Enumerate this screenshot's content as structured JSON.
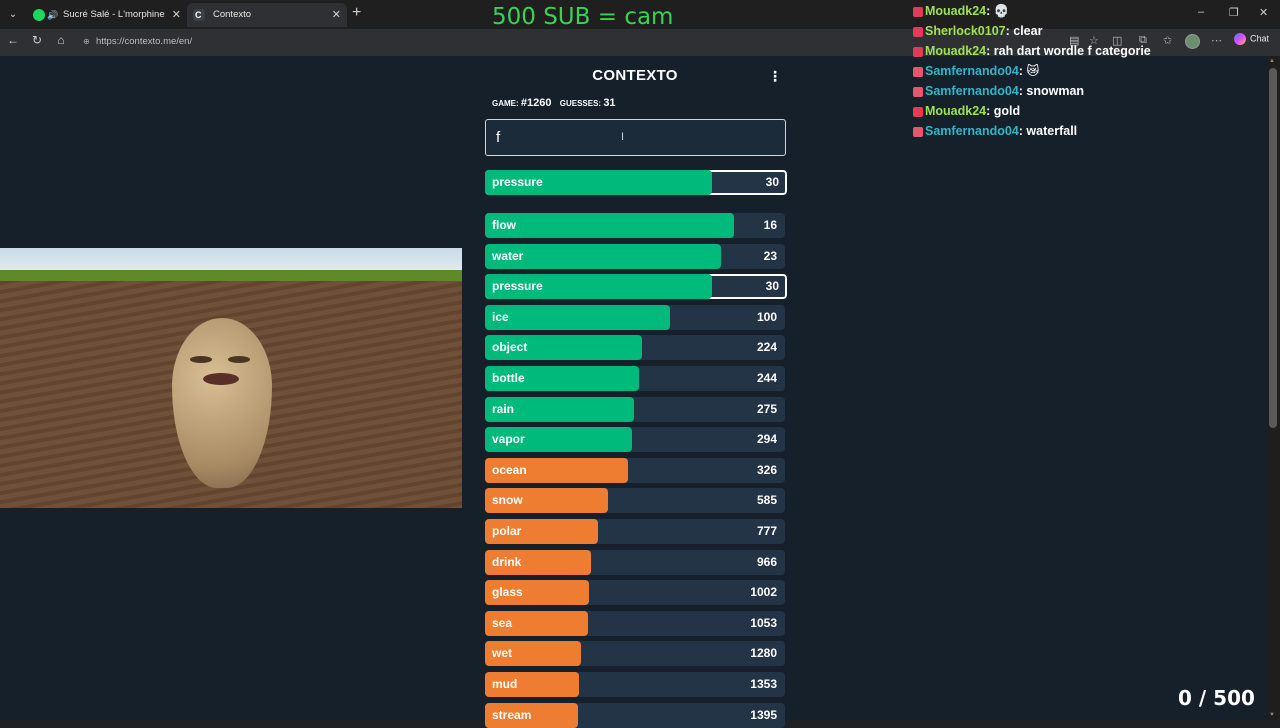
{
  "browser": {
    "tabs": [
      {
        "title": "Sucré Salé - L'morphine",
        "active": false,
        "icon": "spotify-icon"
      },
      {
        "title": "Contexto",
        "active": true,
        "icon": "contexto-icon"
      }
    ],
    "url": "https://contexto.me/en/",
    "chat_label": "Chat"
  },
  "game": {
    "title": "CONTEXTO",
    "game_label": "GAME:",
    "game_number": "#1260",
    "guesses_label": "GUESSES:",
    "guesses_count": "31",
    "input_value": "f",
    "last_guess": {
      "word": "pressure",
      "rank": 30
    },
    "guesses": [
      {
        "word": "flow",
        "rank": 16,
        "color": "#00ba7c"
      },
      {
        "word": "water",
        "rank": 23,
        "color": "#00ba7c"
      },
      {
        "word": "pressure",
        "rank": 30,
        "color": "#00ba7c",
        "highlight": true
      },
      {
        "word": "ice",
        "rank": 100,
        "color": "#00ba7c"
      },
      {
        "word": "object",
        "rank": 224,
        "color": "#00ba7c"
      },
      {
        "word": "bottle",
        "rank": 244,
        "color": "#00ba7c"
      },
      {
        "word": "rain",
        "rank": 275,
        "color": "#00ba7c"
      },
      {
        "word": "vapor",
        "rank": 294,
        "color": "#00ba7c"
      },
      {
        "word": "ocean",
        "rank": 326,
        "color": "#ef7d31"
      },
      {
        "word": "snow",
        "rank": 585,
        "color": "#ef7d31"
      },
      {
        "word": "polar",
        "rank": 777,
        "color": "#ef7d31"
      },
      {
        "word": "drink",
        "rank": 966,
        "color": "#ef7d31"
      },
      {
        "word": "glass",
        "rank": 1002,
        "color": "#ef7d31"
      },
      {
        "word": "sea",
        "rank": 1053,
        "color": "#ef7d31"
      },
      {
        "word": "wet",
        "rank": 1280,
        "color": "#ef7d31"
      },
      {
        "word": "mud",
        "rank": 1353,
        "color": "#ef7d31"
      },
      {
        "word": "stream",
        "rank": 1395,
        "color": "#ef7d31"
      }
    ]
  },
  "overlay": {
    "sub_goal": "500 SUB = cam",
    "counter": "0 / 500",
    "chat": [
      {
        "user": "Mouadk24",
        "text": "💀",
        "color": "#9ee34f",
        "badge": "#e23b5a"
      },
      {
        "user": "Sherlock0107",
        "text": "clear",
        "color": "#9ee34f",
        "badge": "#e23b5a"
      },
      {
        "user": "Mouadk24",
        "text": "rah dart wordle f categorie",
        "color": "#9ee34f",
        "badge": "#e23b5a"
      },
      {
        "user": "Samfernando04",
        "text": "😿",
        "color": "#2fb7c9",
        "badge": "#e8556d"
      },
      {
        "user": "Samfernando04",
        "text": "snowman",
        "color": "#2fb7c9",
        "badge": "#e8556d"
      },
      {
        "user": "Mouadk24",
        "text": "gold",
        "color": "#9ee34f",
        "badge": "#e23b5a"
      },
      {
        "user": "Samfernando04",
        "text": "waterfall",
        "color": "#2fb7c9",
        "badge": "#e8556d"
      }
    ]
  }
}
